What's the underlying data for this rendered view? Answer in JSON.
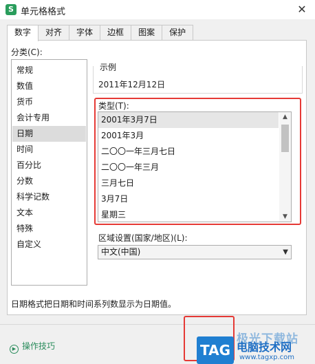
{
  "window": {
    "title": "单元格格式",
    "app_icon": "S"
  },
  "tabs": [
    {
      "label": "数字",
      "active": true
    },
    {
      "label": "对齐",
      "active": false
    },
    {
      "label": "字体",
      "active": false
    },
    {
      "label": "边框",
      "active": false
    },
    {
      "label": "图案",
      "active": false
    },
    {
      "label": "保护",
      "active": false
    }
  ],
  "category": {
    "label": "分类(C):",
    "items": [
      "常规",
      "数值",
      "货币",
      "会计专用",
      "日期",
      "时间",
      "百分比",
      "分数",
      "科学记数",
      "文本",
      "特殊",
      "自定义"
    ],
    "selected": "日期"
  },
  "sample": {
    "label": "示例",
    "value": "2011年12月12日"
  },
  "type": {
    "label": "类型(T):",
    "items": [
      "2001年3月7日",
      "2001年3月",
      "二〇〇一年三月七日",
      "二〇〇一年三月",
      "三月七日",
      "3月7日",
      "星期三"
    ],
    "selected": "2001年3月7日"
  },
  "locale": {
    "label": "区域设置(国家/地区)(L):",
    "value": "中文(中国)"
  },
  "description": "日期格式把日期和时间系列数显示为日期值。",
  "footer": {
    "tips_label": "操作技巧"
  },
  "watermark": {
    "tag": "TAG",
    "top": "极光下载站",
    "title": "电脑技术网",
    "url": "www.tagxp.com"
  },
  "colors": {
    "accent_red": "#e53935",
    "brand_green": "#2a9d5c",
    "watermark_blue": "#1f7fd1"
  }
}
